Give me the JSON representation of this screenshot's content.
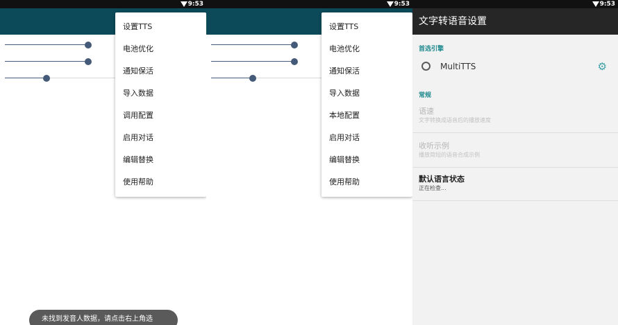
{
  "status": {
    "time": "9:53"
  },
  "left_panel": {
    "sliders": [
      {
        "id": "slider-1",
        "value_fraction": 0.4
      },
      {
        "id": "slider-2",
        "value_fraction": 0.4
      },
      {
        "id": "slider-3",
        "value_fraction": 0.2
      }
    ],
    "menu": [
      "设置TTS",
      "电池优化",
      "通知保活",
      "导入数据",
      "调用配置",
      "启用对话",
      "编辑替换",
      "使用帮助"
    ],
    "toast": "未找到发音人数据，请点击右上角选"
  },
  "middle_panel": {
    "menu": [
      "设置TTS",
      "电池优化",
      "通知保活",
      "导入数据",
      "本地配置",
      "启用对话",
      "编辑替换",
      "使用帮助"
    ]
  },
  "settings": {
    "title": "文字转语音设置",
    "preferred_engine_header": "首选引擎",
    "engine_name": "MultiTTS",
    "general_header": "常规",
    "items": [
      {
        "title": "语速",
        "summary": "文字转换成语音后的播放速度",
        "enabled": false
      },
      {
        "title": "收听示例",
        "summary": "播放简短的语音合成示例",
        "enabled": false
      },
      {
        "title": "默认语言状态",
        "summary": "正在检查...",
        "enabled": true
      }
    ]
  },
  "colors": {
    "appbar_teal": "#0c4a5a",
    "appbar_dark": "#262626",
    "accent": "#1f8a8f",
    "slider": "#445a78"
  },
  "icons": {
    "wifi": "wifi-icon",
    "gear": "gear-icon",
    "radio": "radio-button-icon"
  }
}
